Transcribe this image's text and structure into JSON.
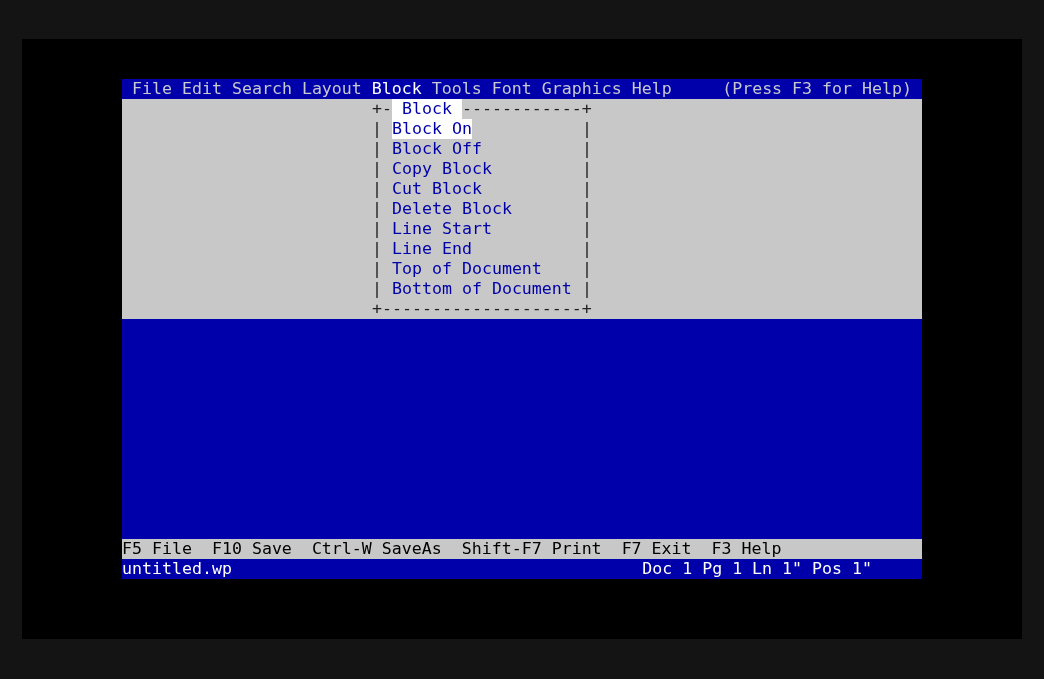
{
  "menu_bar": {
    "items": [
      {
        "label": "File",
        "selected": false
      },
      {
        "label": "Edit",
        "selected": false
      },
      {
        "label": "Search",
        "selected": false
      },
      {
        "label": "Layout",
        "selected": false
      },
      {
        "label": "Block",
        "selected": true
      },
      {
        "label": "Tools",
        "selected": false
      },
      {
        "label": "Font",
        "selected": false
      },
      {
        "label": "Graphics",
        "selected": false
      },
      {
        "label": "Help",
        "selected": false
      }
    ],
    "help_hint": "(Press F3 for Help)"
  },
  "dropdown": {
    "corner_left": "+-",
    "title": "Block",
    "top_right": "------------+",
    "side": "|",
    "bottom": "+--------------------+",
    "items": [
      {
        "label": "Block On",
        "selected": true
      },
      {
        "label": "Block Off",
        "selected": false
      },
      {
        "label": "Copy Block",
        "selected": false
      },
      {
        "label": "Cut Block",
        "selected": false
      },
      {
        "label": "Delete Block",
        "selected": false
      },
      {
        "label": "Line Start",
        "selected": false
      },
      {
        "label": "Line End",
        "selected": false
      },
      {
        "label": "Top of Document",
        "selected": false
      },
      {
        "label": "Bottom of Document",
        "selected": false
      }
    ]
  },
  "function_keys": [
    "F5 File",
    "F10 Save",
    "Ctrl-W SaveAs",
    "Shift-F7 Print",
    "F7 Exit",
    "F3 Help"
  ],
  "status_bar": {
    "filename": "untitled.wp",
    "position": "Doc 1 Pg 1 Ln 1\" Pos 1\""
  }
}
